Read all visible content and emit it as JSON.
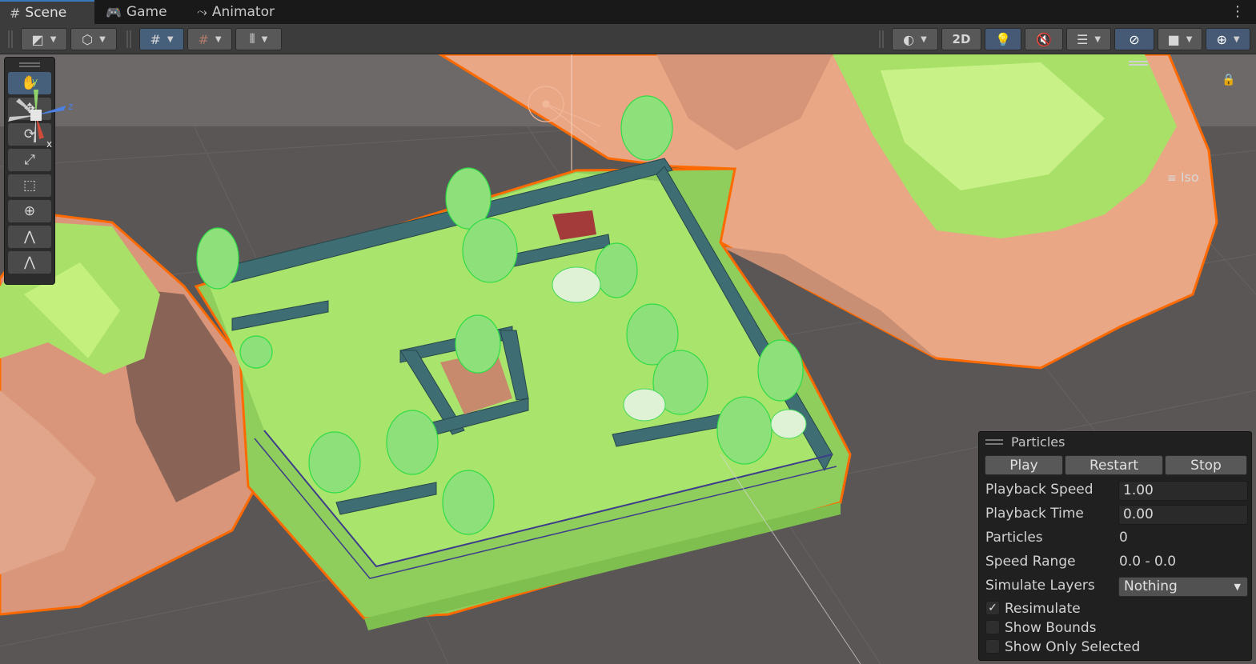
{
  "tabs": [
    {
      "label": "Scene",
      "icon": "#"
    },
    {
      "label": "Game",
      "icon": "🎮"
    },
    {
      "label": "Animator",
      "icon": "⤳"
    }
  ],
  "toolbar": {
    "view_2d_label": "2D"
  },
  "gizmo": {
    "y_label": "y",
    "z_label": "z",
    "x_label": "x",
    "projection_label": "Iso"
  },
  "particles": {
    "title": "Particles",
    "buttons": {
      "play": "Play",
      "restart": "Restart",
      "stop": "Stop"
    },
    "playback_speed_label": "Playback Speed",
    "playback_speed_value": "1.00",
    "playback_time_label": "Playback Time",
    "playback_time_value": "0.00",
    "particles_label": "Particles",
    "particles_value": "0",
    "speed_range_label": "Speed Range",
    "speed_range_value": "0.0 - 0.0",
    "simulate_layers_label": "Simulate Layers",
    "simulate_layers_value": "Nothing",
    "resimulate_label": "Resimulate",
    "resimulate_checked": true,
    "show_bounds_label": "Show Bounds",
    "show_bounds_checked": false,
    "show_only_selected_label": "Show Only Selected",
    "show_only_selected_checked": false
  },
  "colors": {
    "accent": "#3a79bb",
    "selection_outline": "#ff6a00",
    "terrain_green": "#a8e86a",
    "rock_peach": "#e9a786"
  }
}
